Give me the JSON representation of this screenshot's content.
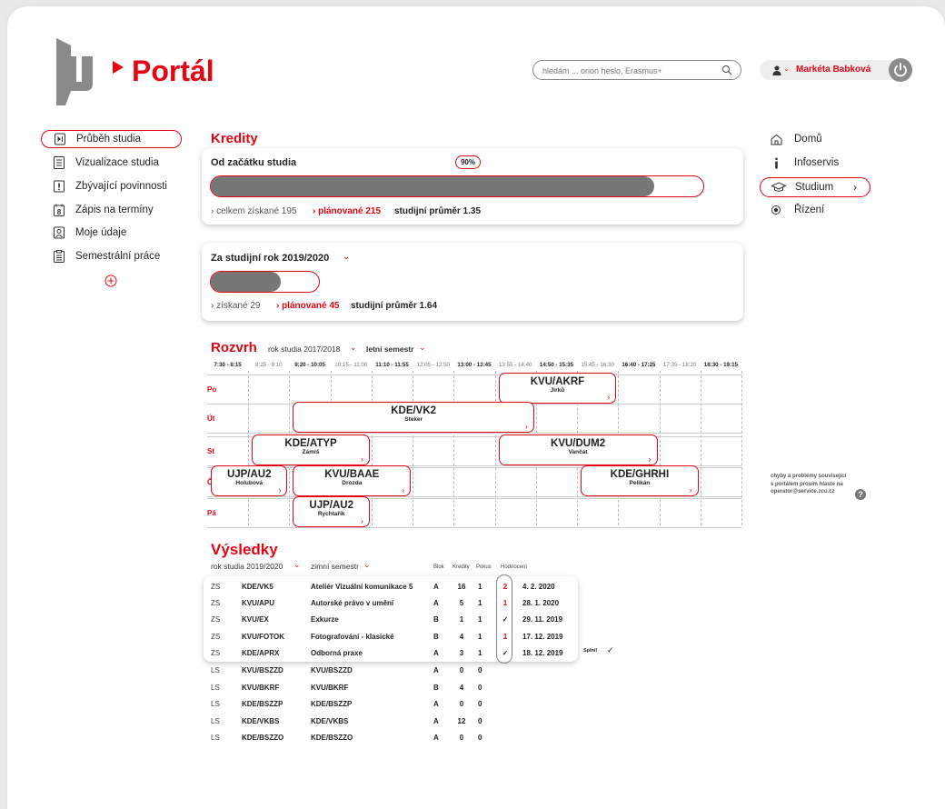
{
  "header": {
    "logo_text": "Portál",
    "search_placeholder": "hledám ... orion heslo, Erasmus+",
    "user_name": "Markéta Babková"
  },
  "left_nav": [
    {
      "label": "Průběh studia",
      "icon": "play-step-icon",
      "active": true
    },
    {
      "label": "Vizualizace studia",
      "icon": "document-list-icon",
      "active": false
    },
    {
      "label": "Zbývající povinnosti",
      "icon": "exclamation-box-icon",
      "active": false
    },
    {
      "label": "Zápis na termíny",
      "icon": "calendar-8-icon",
      "active": false
    },
    {
      "label": "Moje údaje",
      "icon": "person-card-icon",
      "active": false
    },
    {
      "label": "Semestrální práce",
      "icon": "clipboard-icon",
      "active": false
    }
  ],
  "right_nav": [
    {
      "label": "Domů",
      "icon": "home-icon",
      "active": false
    },
    {
      "label": "Infoservis",
      "icon": "info-icon",
      "active": false
    },
    {
      "label": "Studium",
      "icon": "graduation-cap-icon",
      "active": true,
      "chevron": "›"
    },
    {
      "label": "Řízení",
      "icon": "radio-dot-icon",
      "active": false
    }
  ],
  "credits": {
    "title": "Kredity",
    "overall": {
      "title": "Od začátku studia",
      "percent_label": "90%",
      "progress": 0.9,
      "earned": "› celkem získané 195",
      "planned": "› plánované 215",
      "gpa": "studijní průměr 1.35"
    },
    "year": {
      "title": "Za studijní rok 2019/2020",
      "progress": 0.65,
      "earned": "› získané 29",
      "planned": "› plánované 45",
      "gpa": "studijní průměr 1.64"
    }
  },
  "schedule": {
    "title": "Rozvrh",
    "year_filter": "rok studia 2017/2018",
    "semester_filter": "letní semestr",
    "time_slots": [
      {
        "label": "7:30 - 8:15",
        "bold": true
      },
      {
        "label": "8:25 - 9:10",
        "bold": false
      },
      {
        "label": "9:20 - 10:05",
        "bold": true
      },
      {
        "label": "10:15 - 11:00",
        "bold": false
      },
      {
        "label": "11:10 - 11:55",
        "bold": true
      },
      {
        "label": "12:05 - 12:50",
        "bold": false
      },
      {
        "label": "13:00 - 13:45",
        "bold": true
      },
      {
        "label": "13:55 - 14:40",
        "bold": false
      },
      {
        "label": "14:50 - 15:35",
        "bold": true
      },
      {
        "label": "15:45 - 16:30",
        "bold": false
      },
      {
        "label": "16:40 - 17:25",
        "bold": true
      },
      {
        "label": "17:35 - 18:20",
        "bold": false
      },
      {
        "label": "18:30 - 19:15",
        "bold": true
      }
    ],
    "days": [
      "Po",
      "Út",
      "St",
      "Čt",
      "Pá"
    ],
    "events": [
      {
        "day": 0,
        "start": 7,
        "span": 3,
        "code": "KVU/AKRF",
        "teacher": "Jirků"
      },
      {
        "day": 1,
        "start": 2,
        "span": 6,
        "code": "KDE/VK2",
        "teacher": "Steker"
      },
      {
        "day": 2,
        "start": 1,
        "span": 3,
        "code": "KDE/ATYP",
        "teacher": "Zámiš"
      },
      {
        "day": 2,
        "start": 7,
        "span": 4,
        "code": "KVU/DUM2",
        "teacher": "Vančát"
      },
      {
        "day": 3,
        "start": 0,
        "span": 2,
        "code": "UJP/AU2",
        "teacher": "Holubová"
      },
      {
        "day": 3,
        "start": 2,
        "span": 3,
        "code": "KVU/BAAE",
        "teacher": "Drozda"
      },
      {
        "day": 3,
        "start": 9,
        "span": 3,
        "code": "KDE/GHRHI",
        "teacher": "Pelikán"
      },
      {
        "day": 4,
        "start": 2,
        "span": 2,
        "code": "UJP/AU2",
        "teacher": "Rychtařík"
      }
    ],
    "arrow": "›"
  },
  "results": {
    "title": "Výsledky",
    "year_filter": "rok studia 2019/2020",
    "semester_filter": "zimní semestr",
    "col_block": "Blok",
    "col_credits": "Kredity",
    "col_attempt": "Pokus",
    "col_grade": "Hodnocení",
    "fulfilled_label": "Splnil",
    "rows": [
      {
        "sem": "ZS",
        "code": "KDE/VK5",
        "name": "Ateliér Vizuální komunikace 5",
        "block": "A",
        "credits": "16",
        "attempt": "1",
        "grade": "2",
        "date": "4. 2. 2020"
      },
      {
        "sem": "ZS",
        "code": "KVU/APU",
        "name": "Autorské právo v umění",
        "block": "A",
        "credits": "5",
        "attempt": "1",
        "grade": "1",
        "date": "28. 1. 2020"
      },
      {
        "sem": "ZS",
        "code": "KVU/EX",
        "name": "Exkurze",
        "block": "B",
        "credits": "1",
        "attempt": "1",
        "grade": "✓",
        "date": "29. 11. 2019"
      },
      {
        "sem": "ZS",
        "code": "KVU/FOTOK",
        "name": "Fotografování - klasické",
        "block": "B",
        "credits": "4",
        "attempt": "1",
        "grade": "1",
        "date": "17. 12. 2019"
      },
      {
        "sem": "ZS",
        "code": "KDE/APRX",
        "name": "Odborná praxe",
        "block": "A",
        "credits": "3",
        "attempt": "1",
        "grade": "✓",
        "date": "18. 12. 2019"
      },
      {
        "sem": "LS",
        "code": "KVU/BSZZD",
        "name": "KVU/BSZZD",
        "block": "A",
        "credits": "0",
        "attempt": "0",
        "grade": "",
        "date": ""
      },
      {
        "sem": "LS",
        "code": "KVU/BKRF",
        "name": "KVU/BKRF",
        "block": "B",
        "credits": "4",
        "attempt": "0",
        "grade": "",
        "date": ""
      },
      {
        "sem": "LS",
        "code": "KDE/BSZZP",
        "name": "KDE/BSZZP",
        "block": "A",
        "credits": "0",
        "attempt": "0",
        "grade": "",
        "date": ""
      },
      {
        "sem": "LS",
        "code": "KDE/VKBS",
        "name": "KDE/VKBS",
        "block": "A",
        "credits": "12",
        "attempt": "0",
        "grade": "",
        "date": ""
      },
      {
        "sem": "LS",
        "code": "KDE/BSZZO",
        "name": "KDE/BSZZO",
        "block": "A",
        "credits": "0",
        "attempt": "0",
        "grade": "",
        "date": ""
      }
    ]
  },
  "help": {
    "line1": "chyby a problémy související",
    "line2": "s portálem prosím hlaste na",
    "line3": "operator@service.zcu.cz"
  },
  "colors": {
    "accent": "#e30613",
    "bar_fill": "#777777",
    "logo_gray": "#8a8a8a"
  }
}
